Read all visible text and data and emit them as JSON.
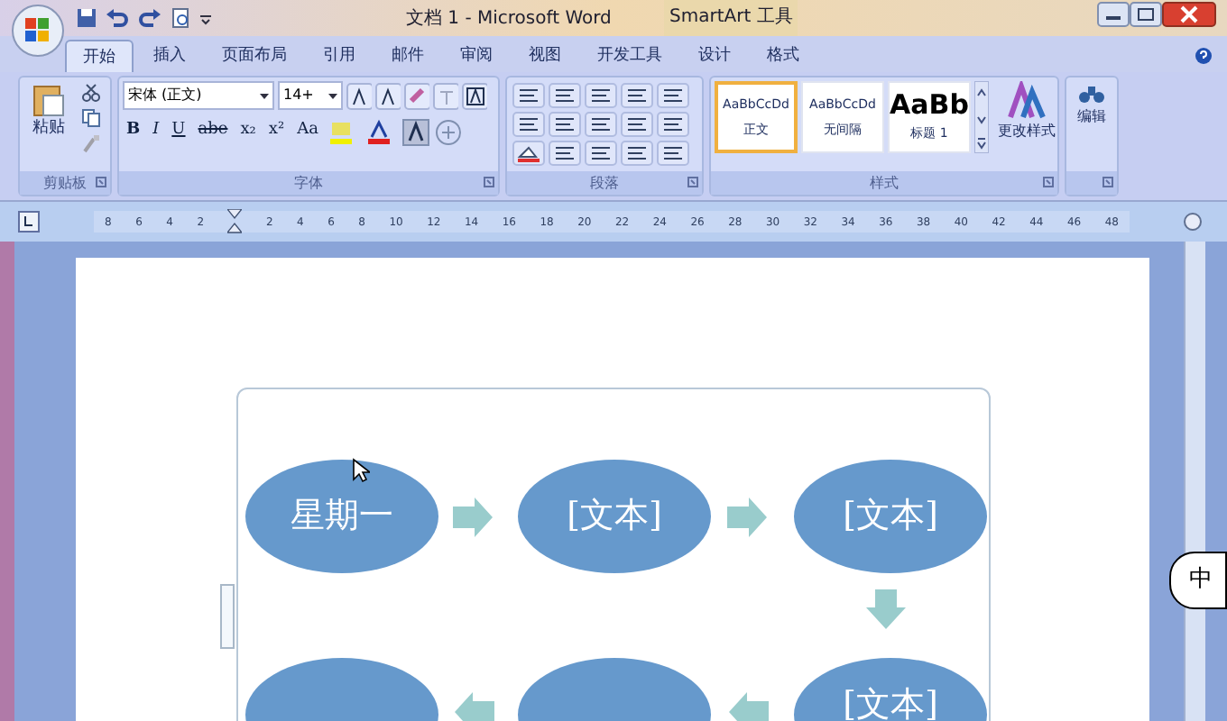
{
  "window": {
    "title": "文档 1 - Microsoft Word",
    "context_tab_group": "SmartArt 工具"
  },
  "tabs": [
    {
      "label": "开始",
      "selected": true
    },
    {
      "label": "插入",
      "selected": false
    },
    {
      "label": "页面布局",
      "selected": false
    },
    {
      "label": "引用",
      "selected": false
    },
    {
      "label": "邮件",
      "selected": false
    },
    {
      "label": "审阅",
      "selected": false
    },
    {
      "label": "视图",
      "selected": false
    },
    {
      "label": "开发工具",
      "selected": false
    },
    {
      "label": "设计",
      "selected": false
    },
    {
      "label": "格式",
      "selected": false
    }
  ],
  "clipboard": {
    "paste_label": "粘贴",
    "group_label": "剪贴板"
  },
  "font": {
    "font_name": "宋体 (正文)",
    "font_size": "14+",
    "group_label": "字体",
    "buttons": [
      "B",
      "I",
      "U",
      "abe",
      "x₂",
      "x²",
      "Aa"
    ]
  },
  "paragraph": {
    "group_label": "段落"
  },
  "styles": {
    "items": [
      {
        "preview": "AaBbCcDd",
        "name": "正文",
        "selected": true
      },
      {
        "preview": "AaBbCcDd",
        "name": "无间隔",
        "selected": false
      },
      {
        "preview": "AaBb",
        "name": "标题 1",
        "selected": false
      }
    ],
    "change_styles": "更改样式",
    "group_label": "样式"
  },
  "editing": {
    "label": "编辑"
  },
  "ruler": {
    "labels": [
      "8",
      "6",
      "4",
      "2",
      "2",
      "4",
      "6",
      "8",
      "10",
      "12",
      "14",
      "16",
      "18",
      "20",
      "22",
      "24",
      "26",
      "28",
      "30",
      "32",
      "34",
      "36",
      "38",
      "40",
      "42",
      "44",
      "46",
      "48"
    ]
  },
  "diagram": {
    "nodes": [
      {
        "kind": "labeled",
        "text": "星期一"
      },
      {
        "kind": "labeled",
        "text": "[文本]"
      },
      {
        "kind": "labeled",
        "text": "[文本]"
      },
      {
        "kind": "labeled",
        "text": "[文本]"
      },
      {
        "kind": "blank"
      },
      {
        "kind": "blank"
      }
    ],
    "arrows": [
      {
        "kind": "right"
      },
      {
        "kind": "right"
      },
      {
        "kind": "down"
      },
      {
        "kind": "left"
      },
      {
        "kind": "left"
      }
    ]
  },
  "ime": {
    "label": "中"
  }
}
